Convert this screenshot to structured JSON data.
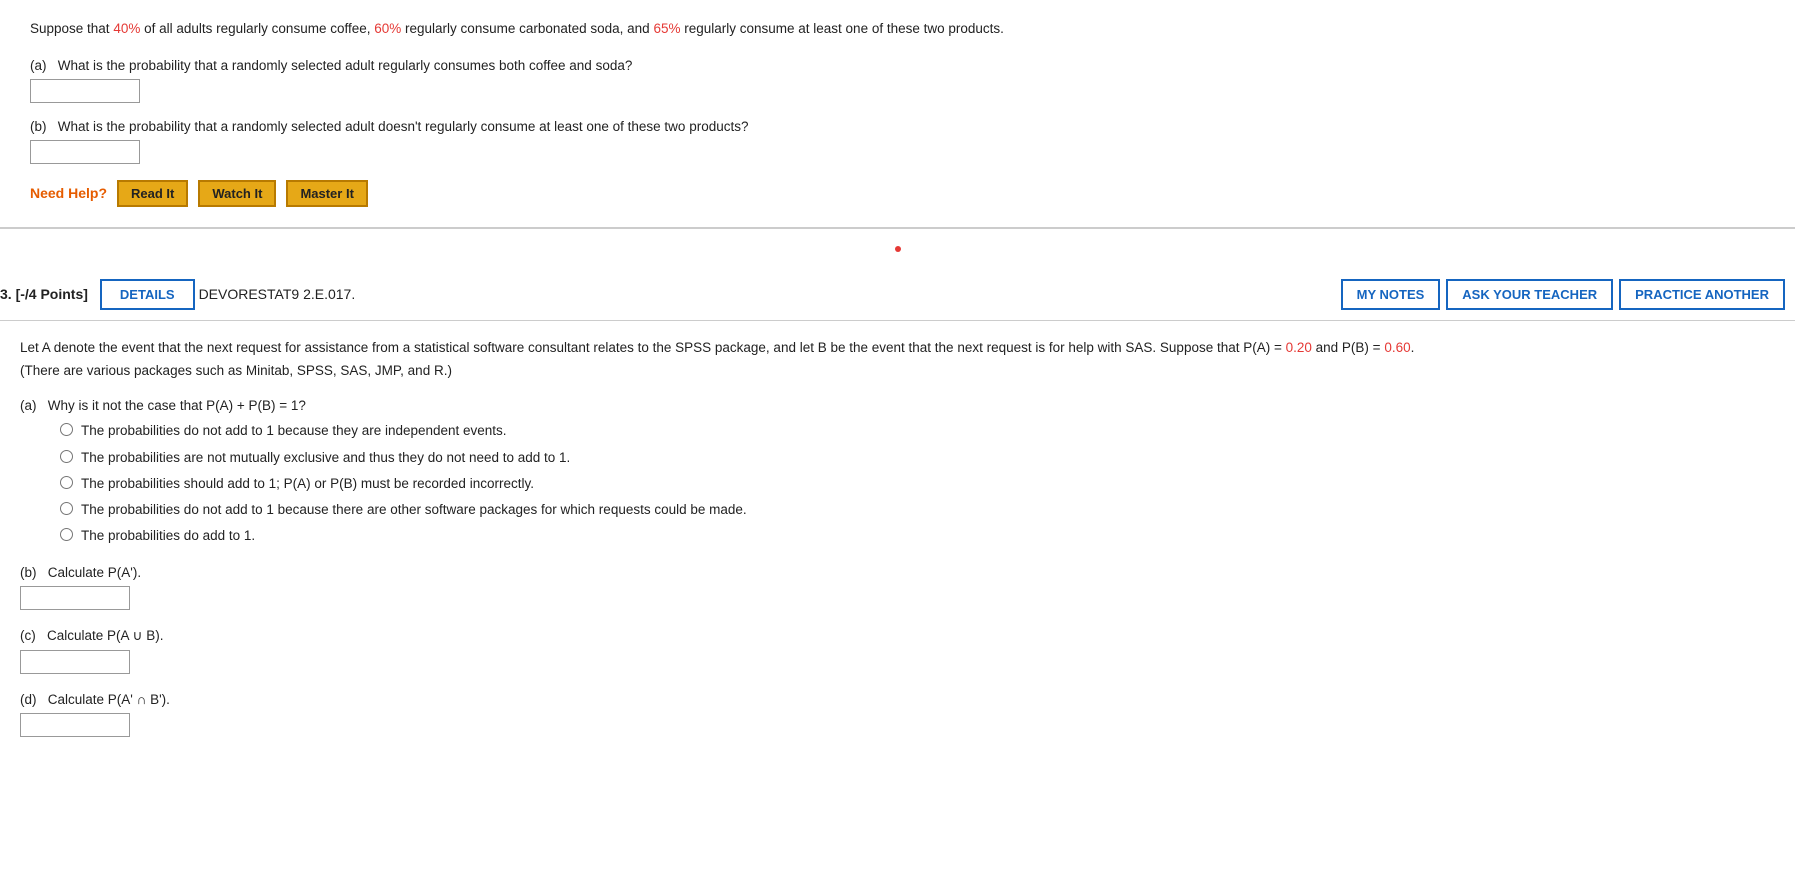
{
  "top": {
    "problem_intro": "Suppose that ",
    "pct_coffee": "40%",
    "text_between_1": " of all adults regularly consume coffee, ",
    "pct_soda": "60%",
    "text_between_2": " regularly consume carbonated soda, and ",
    "pct_either": "65%",
    "text_end": " regularly consume at least one of these two products.",
    "part_a_label": "(a)",
    "part_a_question": "What is the probability that a randomly selected adult regularly consumes both coffee and soda?",
    "part_b_label": "(b)",
    "part_b_question": "What is the probability that a randomly selected adult doesn't regularly consume at least one of these two products?",
    "need_help_label": "Need Help?",
    "btn_read": "Read It",
    "btn_watch": "Watch It",
    "btn_master": "Master It"
  },
  "bottom": {
    "points_label": "3. [-/4 Points]",
    "tab_details": "DETAILS",
    "problem_code": "DEVORESTAT9 2.E.017.",
    "btn_my_notes": "MY NOTES",
    "btn_ask_teacher": "ASK YOUR TEACHER",
    "btn_practice": "PRACTICE ANOTHER",
    "intro_line1": "Let A denote the event that the next request for assistance from a statistical software consultant relates to the SPSS package, and let B be the event that the next request is for help with SAS. Suppose that P(A) = ",
    "pa_value": "0.20",
    "intro_mid": " and P(B) = ",
    "pb_value": "0.60",
    "intro_end": ".",
    "intro_line2": "(There are various packages such as Minitab, SPSS, SAS, JMP, and R.)",
    "part_a_label": "(a)",
    "part_a_question": "Why is it not the case that P(A) + P(B) = 1?",
    "options": [
      "The probabilities do not add to 1 because they are independent events.",
      "The probabilities are not mutually exclusive and thus they do not need to add to 1.",
      "The probabilities should add to 1; P(A) or P(B) must be recorded incorrectly.",
      "The probabilities do not add to 1 because there are other software packages for which requests could be made.",
      "The probabilities do add to 1."
    ],
    "part_b_label": "(b)",
    "part_b_question": "Calculate P(A').",
    "part_c_label": "(c)",
    "part_c_question": "Calculate P(A ∪ B).",
    "part_d_label": "(d)",
    "part_d_question": "Calculate P(A' ∩ B')."
  }
}
